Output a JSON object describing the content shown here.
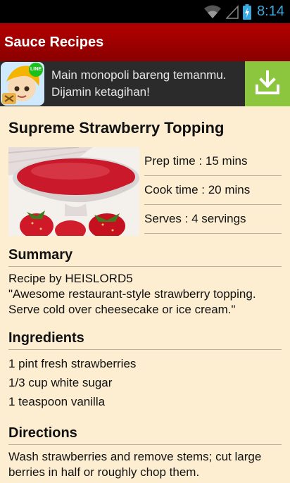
{
  "status_bar": {
    "time": "8:14",
    "icons": [
      "wifi-icon",
      "signal-icon",
      "battery-icon"
    ],
    "clock_color": "#39a9e0"
  },
  "app_bar": {
    "title": "Sauce Recipes",
    "color": "#a00000"
  },
  "ad": {
    "logo_badge": "LINE",
    "text": "Main monopoli bareng temanmu. Dijamin ketagihan!",
    "download_icon": "download-icon",
    "accent": "#8cc63f"
  },
  "recipe": {
    "title": "Supreme Strawberry Topping",
    "prep_time": "Prep time : 15 mins",
    "cook_time": "Cook time : 20 mins",
    "serves": "Serves : 4 servings"
  },
  "summary": {
    "heading": "Summary",
    "author": "Recipe by HEISLORD5",
    "quote": "\"Awesome restaurant-style strawberry topping. Serve cold over cheesecake or ice cream.\""
  },
  "ingredients": {
    "heading": "Ingredients",
    "items": [
      "1 pint fresh strawberries",
      "1/3 cup white sugar",
      "1 teaspoon vanilla"
    ]
  },
  "directions": {
    "heading": "Directions",
    "text": "Wash strawberries and remove stems; cut large berries in half or roughly chop them."
  }
}
